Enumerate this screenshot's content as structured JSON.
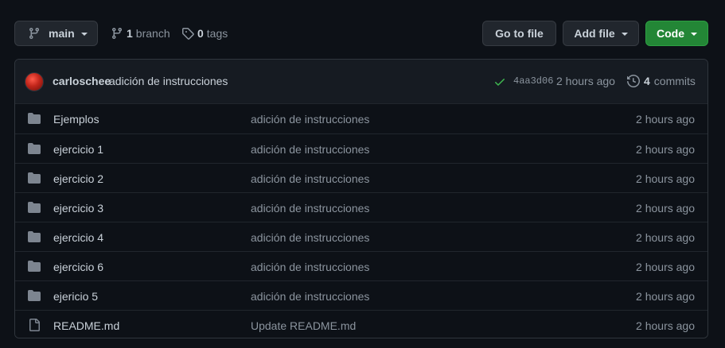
{
  "toolbar": {
    "branch_label": "main",
    "branches_count": "1",
    "branches_label": "branch",
    "tags_count": "0",
    "tags_label": "tags",
    "goto_label": "Go to file",
    "addfile_label": "Add file",
    "code_label": "Code"
  },
  "commit": {
    "author": "carloschee",
    "message": "adición de instrucciones",
    "sha": "4aa3d06",
    "time": "2 hours ago",
    "commits_count": "4",
    "commits_label": "commits"
  },
  "files": [
    {
      "type": "folder",
      "name": "Ejemplos",
      "message": "adición de instrucciones",
      "time": "2 hours ago"
    },
    {
      "type": "folder",
      "name": "ejercicio 1",
      "message": "adición de instrucciones",
      "time": "2 hours ago"
    },
    {
      "type": "folder",
      "name": "ejercicio 2",
      "message": "adición de instrucciones",
      "time": "2 hours ago"
    },
    {
      "type": "folder",
      "name": "ejercicio 3",
      "message": "adición de instrucciones",
      "time": "2 hours ago"
    },
    {
      "type": "folder",
      "name": "ejercicio 4",
      "message": "adición de instrucciones",
      "time": "2 hours ago"
    },
    {
      "type": "folder",
      "name": "ejercicio 6",
      "message": "adición de instrucciones",
      "time": "2 hours ago"
    },
    {
      "type": "folder",
      "name": "ejericio 5",
      "message": "adición de instrucciones",
      "time": "2 hours ago"
    },
    {
      "type": "file",
      "name": "README.md",
      "message": "Update README.md",
      "time": "2 hours ago"
    }
  ],
  "colors": {
    "background": "#0d1117",
    "text": "#c9d1d9",
    "muted": "#8b949e",
    "code_button": "#238636",
    "check": "#3fb950"
  }
}
